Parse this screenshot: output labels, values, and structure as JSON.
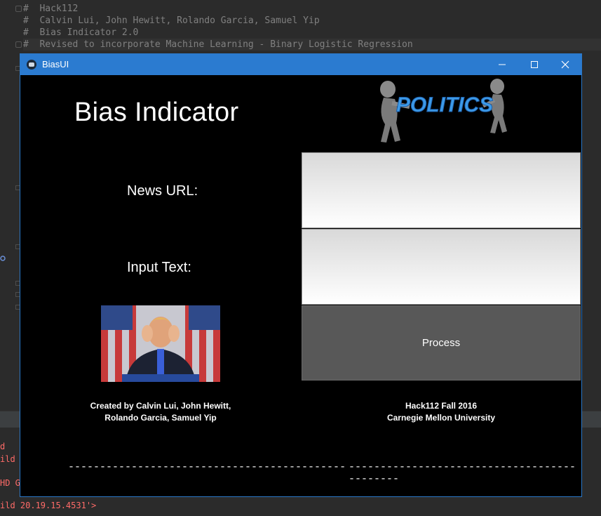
{
  "ide": {
    "code_lines": [
      "#  Hack112",
      "#  Calvin Lui, John Hewitt, Rolando Garcia, Samuel Yip",
      "#  Bias Indicator 2.0",
      "#  Revised to incorporate Machine Learning - Binary Logistic Regression"
    ],
    "console_lines": [
      "d",
      "ild",
      "HD G",
      "ild 20.19.15.4531'>"
    ]
  },
  "window": {
    "title": "BiasUI",
    "minimize_icon": "minimize-icon",
    "maximize_icon": "maximize-icon",
    "close_icon": "close-icon"
  },
  "app": {
    "heading": "Bias Indicator",
    "politics_image_text": "POLITICS",
    "news_url_label": "News URL:",
    "input_text_label": "Input Text:",
    "news_url_value": "",
    "input_text_value": "",
    "process_label": "Process",
    "credit_left_line1": "Created by Calvin Lui, John Hewitt,",
    "credit_left_line2": "Rolando Garcia, Samuel Yip",
    "credit_right_line1": "Hack112 Fall 2016",
    "credit_right_line2": "Carnegie Mellon University",
    "dashes_left": "--------------------------------------------",
    "dashes_right": "--------------------------------------------"
  },
  "colors": {
    "titlebar": "#2b7bd0",
    "window_bg": "#000000",
    "button_bg": "#585858"
  }
}
